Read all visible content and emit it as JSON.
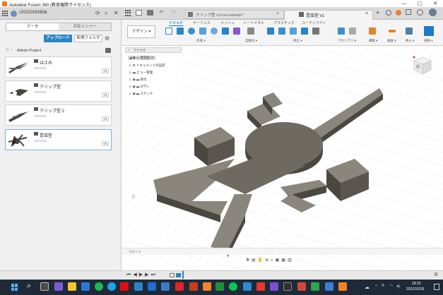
{
  "window": {
    "title": "Autodesk Fusion 360 (教育機関ライセンス)",
    "controls": [
      "—",
      "▢",
      "✕"
    ]
  },
  "tabs": {
    "user": "r2022019SBdk",
    "doc_tab_1": "クリップ型 v1<recovered>*",
    "doc_tab_2": "昆虫型 v1",
    "close_glyph": "×"
  },
  "left_panel": {
    "tab_data": "データ",
    "tab_members": "共有メンバー",
    "upload": "アップロード",
    "new_folder": "新規フォルダ",
    "breadcrumb": "Admin Project",
    "files": [
      {
        "name": "はさみ",
        "date": "10/13/22",
        "version": "V1"
      },
      {
        "name": "クリップ型",
        "date": "10/13/22",
        "version": "V1"
      },
      {
        "name": "クリップ型 2",
        "date": "10/14/22",
        "version": "V1"
      },
      {
        "name": "昆虫型",
        "date": "10/13/22",
        "version": "V1"
      }
    ]
  },
  "toolbar": {
    "workspace": "デザイン ▾",
    "tabs": [
      "ソリッド",
      "サーフェス",
      "メッシュ",
      "シートメタル",
      "プラスチック",
      "ユーティリティ"
    ],
    "groups": [
      "作成 ▾",
      "自動化 ▾",
      "修正 ▾",
      "アセンブリ ▾",
      "構築 ▾",
      "検査 ▾",
      "挿入 ▾",
      "選択 ▾"
    ]
  },
  "browser": {
    "header": "ブラウザ",
    "root": "昆虫型 v1",
    "items": [
      "ドキュメントの設定",
      "ビュー管理",
      "原点",
      "ボディ",
      "スケッチ"
    ]
  },
  "viewcube": {
    "face": "前"
  },
  "comments": "コメント",
  "taskbar": {
    "time": "18:15",
    "date": "2022/10/18",
    "search_icon": "search-icon"
  },
  "colors": {
    "accent": "#2a84c6",
    "model": "#6e6a62",
    "model_dark": "#4a4741",
    "model_light": "#8a867d"
  }
}
